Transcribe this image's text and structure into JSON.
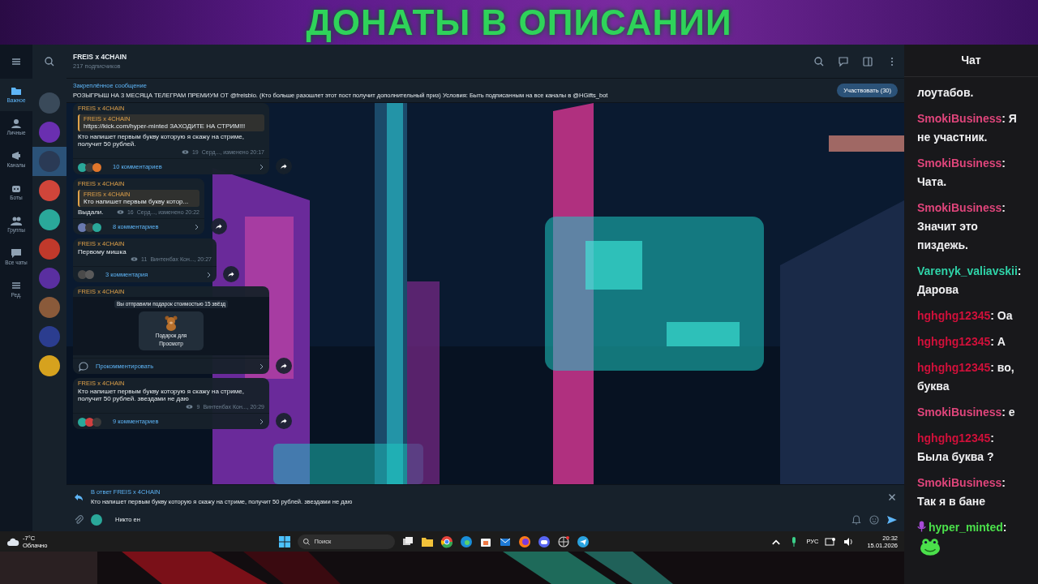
{
  "banner": {
    "text": "ДОНАТЫ В ОПИСАНИИ"
  },
  "folders": [
    {
      "label": "Важное",
      "selected": true
    },
    {
      "label": "Личные",
      "selected": false
    },
    {
      "label": "Каналы",
      "selected": false
    },
    {
      "label": "Боты",
      "selected": false
    },
    {
      "label": "Группы",
      "selected": false
    },
    {
      "label": "Все чаты",
      "selected": false
    },
    {
      "label": "Ред.",
      "selected": false
    }
  ],
  "chats": [
    {
      "color": "#3a4a5a",
      "selected": false
    },
    {
      "color": "#6a2fb0",
      "selected": false
    },
    {
      "color": "#2a3a55",
      "selected": true
    },
    {
      "color": "#d0453a",
      "selected": false
    },
    {
      "color": "#2aa89a",
      "selected": false
    },
    {
      "color": "#c0392b",
      "selected": false
    },
    {
      "color": "#5a2fa0",
      "selected": false
    },
    {
      "color": "#8a5a3a",
      "selected": false
    },
    {
      "color": "#2b3d8f",
      "selected": false
    },
    {
      "color": "#d6a21e",
      "selected": false
    }
  ],
  "header": {
    "title": "FREIS x 4CHAIN",
    "subscribers": "217 подписчиков"
  },
  "pinned": {
    "label": "Закреплённое сообщение",
    "text": "РОЗЫГРЫШ НА 3 МЕСЯЦА ТЕЛЕГРАМ ПРЕМИУМ ОТ @freisbio. (Кто больше разошлет этот пост получит дополнительный приз)  Условия: Быть подписанным на все каналы в @HGifts_bot",
    "button": "Участвовать (30)"
  },
  "posts": [
    {
      "kind": "text",
      "author": "FREIS x 4CHAIN",
      "quote": {
        "author": "FREIS x 4CHAIN",
        "text": "https://kick.com/hyper-minted ЗАХОДИТЕ НА СТРИМ!!!"
      },
      "text": "Кто напишет первым букву которую я скажу на стриме, получит 50 рублей.",
      "views": "19",
      "meta": "Серд..., изменено 20:17",
      "comments": "10 комментариев",
      "commenters": [
        {
          "color": "#2aa89a"
        },
        {
          "color": "#3b3b3b"
        },
        {
          "color": "#e0762b"
        }
      ]
    },
    {
      "kind": "text",
      "author": "FREIS x 4CHAIN",
      "quote": {
        "author": "FREIS x 4CHAIN",
        "text": "Кто напишет первым букву котор..."
      },
      "text": "Выдали.",
      "views": "16",
      "meta": "Серд..., изменено 20:22",
      "comments": "8 комментариев",
      "commenters": [
        {
          "color": "#6a7ab0"
        },
        {
          "color": "#3b3b3b"
        },
        {
          "color": "#2aa89a"
        }
      ]
    },
    {
      "kind": "text",
      "author": "FREIS x 4CHAIN",
      "text": "Первому мишка",
      "views": "11",
      "meta": "Винтенбах Кон..., 20:27",
      "comments": "3 комментария",
      "commenters": [
        {
          "color": "#4a4a4a"
        },
        {
          "color": "#5a5a5a"
        }
      ]
    },
    {
      "kind": "gift",
      "author": "FREIS x 4CHAIN",
      "caption": "Вы отправили подарок стоимостью 15 звёзд",
      "gift_title": "Подарок для",
      "gift_button": "Просмотр",
      "comment": "Прокомментировать"
    },
    {
      "kind": "text",
      "author": "FREIS x 4CHAIN",
      "text": "Кто напишет первым букву которую я скажу на стриме, получит 50 рублей. звездами не даю",
      "views": "9",
      "meta": "Винтенбах Кон..., 20:29",
      "comments": "9 комментариев",
      "commenters": [
        {
          "color": "#2aa89a"
        },
        {
          "color": "#d04040"
        },
        {
          "color": "#3b3b3b"
        }
      ]
    }
  ],
  "reply": {
    "label": "В ответ FREIS x 4CHAIN",
    "text": "Кто напишет первым букву которую я скажу на стриме, получит 50 рублей. звездами не даю"
  },
  "composer": {
    "value": "Никто ен"
  },
  "taskbar": {
    "temperature": "-7°C",
    "weather": "Облачно",
    "search_placeholder": "Поиск",
    "language": "РУС",
    "time": "20:32",
    "date": "15.01.2026"
  },
  "chat": {
    "title": "Чат",
    "messages": [
      {
        "text": "лоутабов."
      },
      {
        "user": "SmokiBusiness",
        "color": "#e0457b",
        "text": ": Я не участник."
      },
      {
        "user": "SmokiBusiness",
        "color": "#e0457b",
        "text": ": Чата."
      },
      {
        "user": "SmokiBusiness",
        "color": "#e0457b",
        "text": ": Значит это пиздежь."
      },
      {
        "user": "Varenyk_valiavskii",
        "color": "#2fd3a8",
        "text": ": Дарова"
      },
      {
        "user": "hghghg12345",
        "color": "#d0103a",
        "text": ": Оа"
      },
      {
        "user": "hghghg12345",
        "color": "#d0103a",
        "text": ": А"
      },
      {
        "user": "hghghg12345",
        "color": "#d0103a",
        "text": ": во, буква"
      },
      {
        "user": "SmokiBusiness",
        "color": "#e0457b",
        "text": ": е"
      },
      {
        "user": "hghghg12345",
        "color": "#d0103a",
        "text": ": Была буква ?"
      },
      {
        "user": "SmokiBusiness",
        "color": "#e0457b",
        "text": ": Так я в бане"
      },
      {
        "user": "hyper_minted",
        "color": "#4be04b",
        "text": ":",
        "kind": "emote"
      }
    ]
  }
}
